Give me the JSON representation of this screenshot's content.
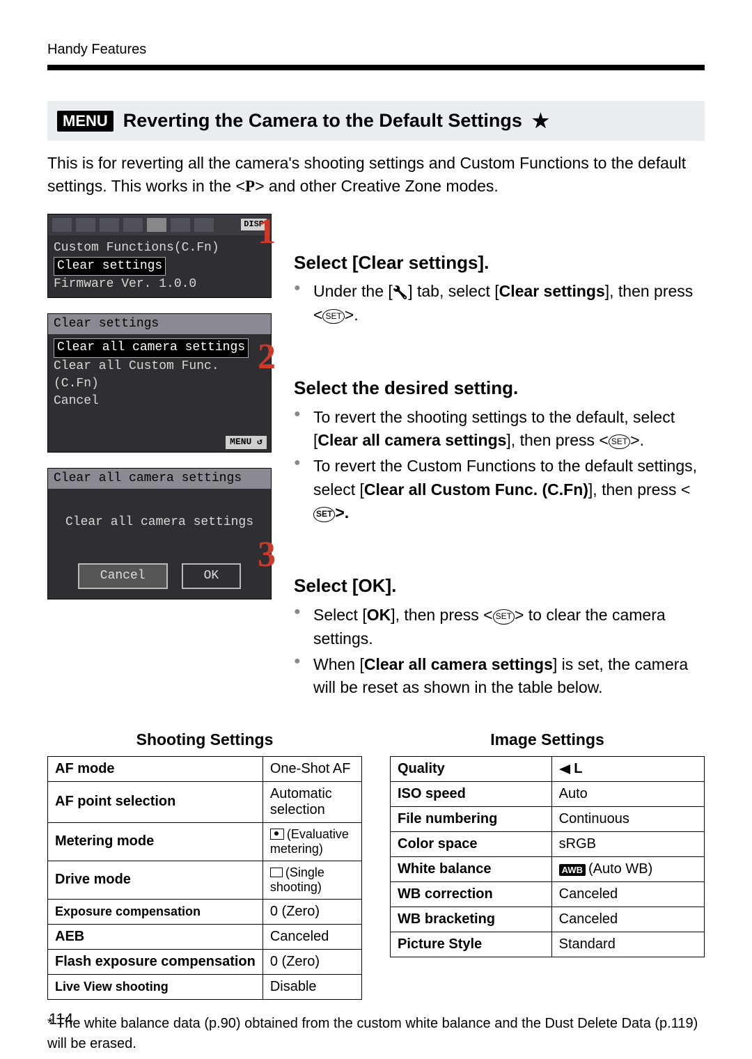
{
  "header": "Handy Features",
  "menu_label": "MENU",
  "title": "Reverting the Camera to the Default Settings",
  "star": "★",
  "lead_a": "This is for reverting all the camera's shooting settings and Custom Functions to the default settings. This works in the <",
  "lead_b": "> and other Creative Zone modes.",
  "P": "P",
  "shot1": {
    "disp": "DISP",
    "l1": "Custom Functions(C.Fn)",
    "l2": "Clear settings",
    "l3": "Firmware Ver. 1.0.0"
  },
  "shot2": {
    "title": "Clear settings",
    "l1": "Clear all camera settings",
    "l2": "Clear all Custom Func. (C.Fn)",
    "l3": "Cancel",
    "menu": "MENU ↺"
  },
  "shot3": {
    "title": "Clear all camera settings",
    "mid": "Clear all camera settings",
    "cancel": "Cancel",
    "ok": "OK"
  },
  "set": "SET",
  "step1": {
    "h": "Select [Clear settings].",
    "p1a": "Under the [",
    "p1b": "] tab, select [",
    "p1c": "Clear settings",
    "p1d": "], then press <",
    "p1e": ">."
  },
  "step2": {
    "h": "Select the desired setting.",
    "p1a": "To revert the shooting settings to the default, select [",
    "p1b": "Clear all camera settings",
    "p1c": "], then press <",
    "p1d": ">.",
    "p2a": "To revert the Custom Functions to the default settings, select [",
    "p2b": "Clear all Custom Func. (C.Fn)",
    "p2c": "], then press <",
    "p2d": ">."
  },
  "step3": {
    "h": "Select [OK].",
    "p1a": "Select [",
    "p1b": "OK",
    "p1c": "], then press <",
    "p1d": "> to clear the camera settings.",
    "p2a": "When [",
    "p2b": "Clear all camera settings",
    "p2c": "] is set, the camera will be reset as shown in the table below."
  },
  "t1": {
    "title": "Shooting Settings",
    "rows": [
      [
        "AF mode",
        "One-Shot AF"
      ],
      [
        "AF point selection",
        "Automatic selection"
      ],
      [
        "Metering mode",
        "(Evaluative metering)"
      ],
      [
        "Drive mode",
        "(Single shooting)"
      ],
      [
        "Exposure compensation",
        "0 (Zero)"
      ],
      [
        "AEB",
        "Canceled"
      ],
      [
        "Flash exposure compensation",
        "0 (Zero)"
      ],
      [
        "Live View shooting",
        "Disable"
      ]
    ]
  },
  "t2": {
    "title": "Image Settings",
    "rows": [
      [
        "Quality",
        "L"
      ],
      [
        "ISO speed",
        "Auto"
      ],
      [
        "File numbering",
        "Continuous"
      ],
      [
        "Color space",
        "sRGB"
      ],
      [
        "White balance",
        "(Auto WB)"
      ],
      [
        "WB correction",
        "Canceled"
      ],
      [
        "WB bracketing",
        "Canceled"
      ],
      [
        "Picture Style",
        "Standard"
      ]
    ]
  },
  "footnote": "* The white balance data (p.90) obtained from the custom white balance and the Dust Delete Data (p.119) will be erased.",
  "page": "114"
}
